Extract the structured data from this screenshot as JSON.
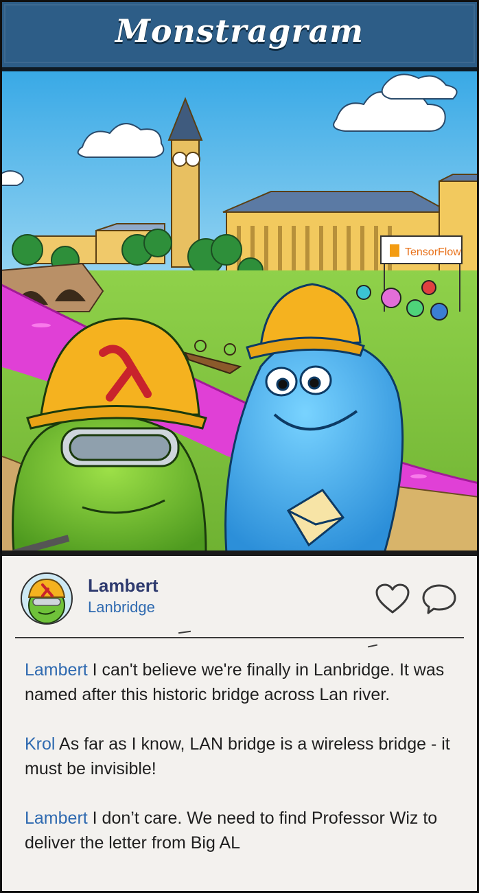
{
  "app": {
    "title": "Monstragram"
  },
  "colors": {
    "header": "#2d5d87",
    "card": "#f3f1ee",
    "username": "#2e3a6e",
    "link": "#2f6ab0",
    "river": "#e040d6"
  },
  "post": {
    "image_alt": "Lambert and Krol selfie in Lanbridge",
    "user": {
      "name": "Lambert",
      "location": "Lanbridge"
    },
    "icons": {
      "like": "heart-icon",
      "comment": "speech-bubble-icon"
    },
    "scene_sign": "TensorFlow",
    "comments": [
      {
        "author": "Lambert",
        "text": "  I can't believe we're finally in Lanbridge. It was named after this historic bridge across Lan river."
      },
      {
        "author": "Krol",
        "text": " As far as I know, LAN bridge is a wireless bridge - it must be invisible!"
      },
      {
        "author": "Lambert",
        "text": "  I don’t care. We need to find Professor Wiz to deliver the letter from Big AL"
      }
    ]
  }
}
